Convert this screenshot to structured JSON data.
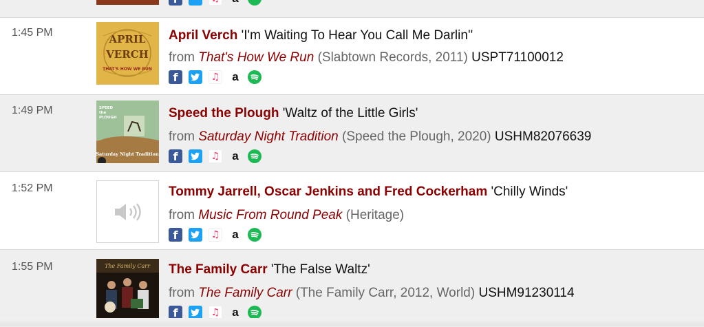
{
  "tracks": [
    {
      "time": "1:45 PM",
      "artist": "April Verch",
      "song": "'I'm Waiting To Hear You Call Me Darlin''",
      "album": "That's How We Run",
      "details": "(Slabtown Records, 2011)",
      "isrc": "USPT71100012",
      "art_text": [
        "APRIL",
        "VERCH",
        "THAT'S HOW WE RUN"
      ]
    },
    {
      "time": "1:49 PM",
      "artist": "Speed the Plough",
      "song": "'Waltz of the Little Girls'",
      "album": "Saturday Night Tradition",
      "details": "(Speed the Plough, 2020)",
      "isrc": "USHM82076639",
      "art_text": [
        "SPEED",
        "the",
        "PLOUGH",
        "Saturday Night Tradition"
      ]
    },
    {
      "time": "1:52 PM",
      "artist": "Tommy Jarrell, Oscar Jenkins and Fred Cockerham",
      "song": "'Chilly Winds'",
      "album": "Music From Round Peak",
      "details": "(Heritage)",
      "isrc": ""
    },
    {
      "time": "1:55 PM",
      "artist": "The Family Carr",
      "song": "'The False Waltz'",
      "album": "The Family Carr",
      "details": "(The Family Carr, 2012, World)",
      "isrc": "USHM91230114"
    }
  ],
  "labels": {
    "from": "from"
  },
  "icons": [
    "facebook-icon",
    "twitter-icon",
    "apple-music-icon",
    "amazon-icon",
    "spotify-icon"
  ],
  "colors": {
    "artist": "#8b0000",
    "facebook": "#3b5998",
    "twitter": "#1da1f2",
    "spotify": "#1db954",
    "apple": "#ef3b66"
  }
}
